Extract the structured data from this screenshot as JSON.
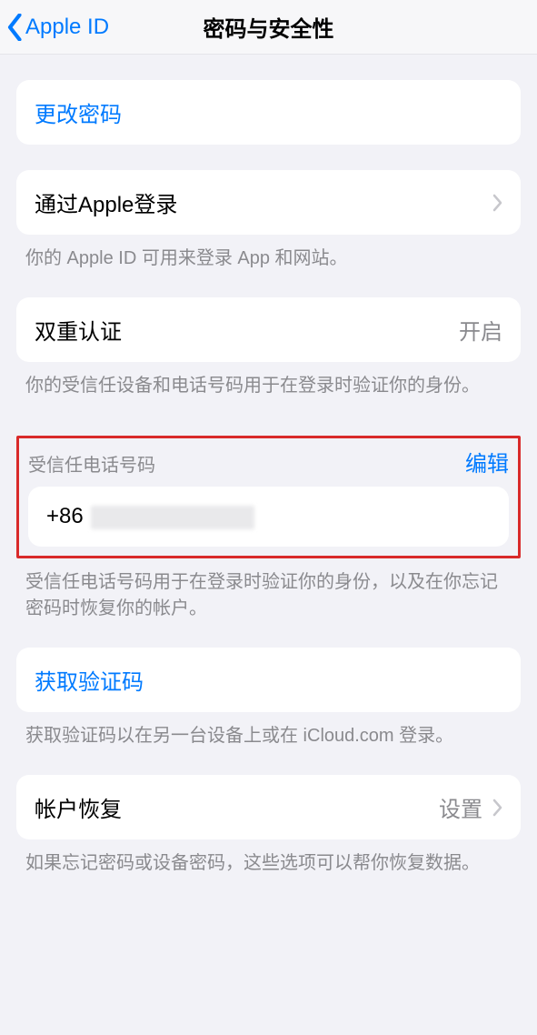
{
  "nav": {
    "back_label": "Apple ID",
    "title": "密码与安全性"
  },
  "change_password": {
    "label": "更改密码"
  },
  "sign_in_with_apple": {
    "label": "通过Apple登录",
    "footer": "你的 Apple ID 可用来登录 App 和网站。"
  },
  "two_factor": {
    "label": "双重认证",
    "value": "开启",
    "footer": "你的受信任设备和电话号码用于在登录时验证你的身份。"
  },
  "trusted_phone": {
    "header": "受信任电话号码",
    "edit": "编辑",
    "number_prefix": "+86",
    "footer": "受信任电话号码用于在登录时验证你的身份，以及在你忘记密码时恢复你的帐户。"
  },
  "get_code": {
    "label": "获取验证码",
    "footer": "获取验证码以在另一台设备上或在 iCloud.com 登录。"
  },
  "account_recovery": {
    "label": "帐户恢复",
    "value": "设置",
    "footer": "如果忘记密码或设备密码，这些选项可以帮你恢复数据。"
  }
}
